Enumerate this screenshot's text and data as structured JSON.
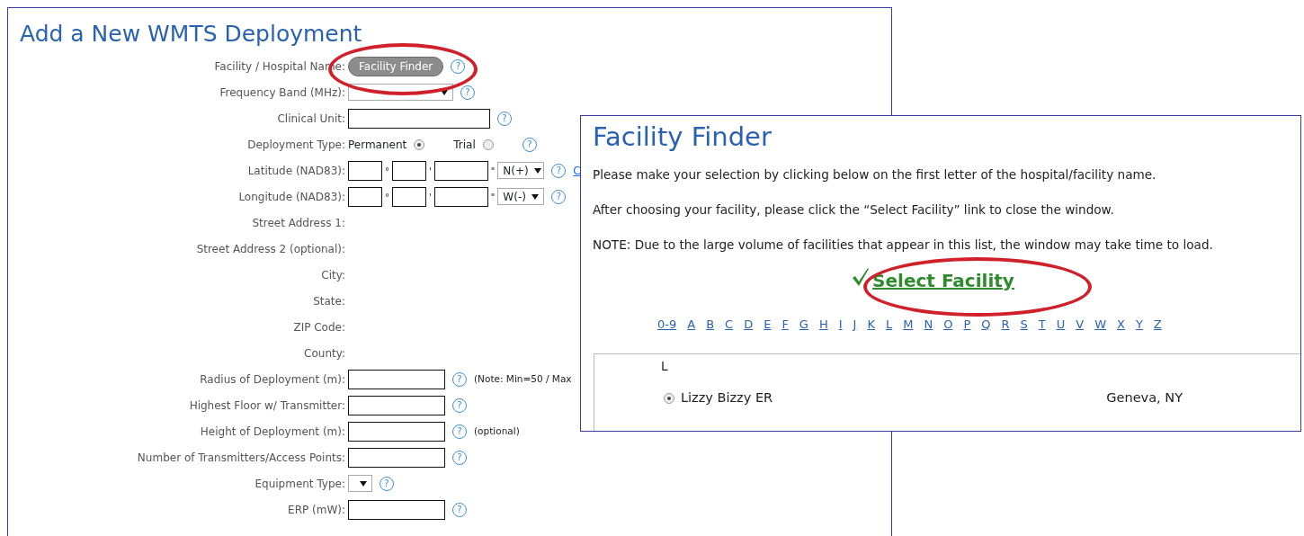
{
  "form": {
    "title": "Add a New WMTS Deployment",
    "rows": [
      {
        "label": "Facility / Hospital Name:",
        "kind": "button",
        "button": "Facility Finder",
        "help": "?"
      },
      {
        "label": "Frequency Band (MHz):",
        "kind": "wide_select",
        "help": "?"
      },
      {
        "label": "Clinical Unit:",
        "kind": "wide_text",
        "help": "?"
      },
      {
        "label": "Deployment Type:",
        "kind": "radio",
        "options": [
          {
            "label": "Permanent",
            "selected": true
          },
          {
            "label": "Trial",
            "selected": false
          }
        ],
        "help": "?"
      },
      {
        "label": "Latitude (NAD83):",
        "kind": "coord",
        "units": [
          "°",
          "'",
          "\""
        ],
        "value": "N(+)",
        "help": "?",
        "link": "C"
      },
      {
        "label": "Longitude (NAD83):",
        "kind": "coord",
        "units": [
          "°",
          "'",
          "\""
        ],
        "value": "W(-)",
        "help": "?"
      },
      {
        "label": "Street Address 1:",
        "kind": "static"
      },
      {
        "label": "Street Address 2 (optional):",
        "kind": "static"
      },
      {
        "label": "City:",
        "kind": "static"
      },
      {
        "label": "State:",
        "kind": "static"
      },
      {
        "label": "ZIP Code:",
        "kind": "static"
      },
      {
        "label": "County:",
        "kind": "static"
      },
      {
        "label": "Radius of Deployment (m):",
        "kind": "text",
        "help": "?",
        "note": "(Note: Min=50 / Max"
      },
      {
        "label": "Highest Floor w/ Transmitter:",
        "kind": "text",
        "help": "?"
      },
      {
        "label": "Height of Deployment (m):",
        "kind": "text",
        "help": "?",
        "note": "(optional)"
      },
      {
        "label": "Number of Transmitters/Access Points:",
        "kind": "text",
        "help": "?"
      },
      {
        "label": "Equipment Type:",
        "kind": "select",
        "help": "?"
      },
      {
        "label": "ERP (mW):",
        "kind": "text",
        "help": "?"
      }
    ]
  },
  "finder": {
    "title": "Facility Finder",
    "paragraphs": [
      "Please make your selection by clicking below on the first letter of the hospital/facility name.",
      "After choosing your facility, please click the “Select Facility” link to close the window.",
      "NOTE: Due to the large volume of facilities that appear in this list, the window may take time to load."
    ],
    "select_link": "Select Facility",
    "letters": [
      "0-9",
      "A",
      "B",
      "C",
      "D",
      "E",
      "F",
      "G",
      "H",
      "I",
      "J",
      "K",
      "L",
      "M",
      "N",
      "O",
      "P",
      "Q",
      "R",
      "S",
      "T",
      "U",
      "V",
      "W",
      "X",
      "Y",
      "Z"
    ],
    "group": "L",
    "facilities": [
      {
        "name": "Lizzy Bizzy ER",
        "location": "Geneva, NY",
        "selected": true
      }
    ]
  }
}
